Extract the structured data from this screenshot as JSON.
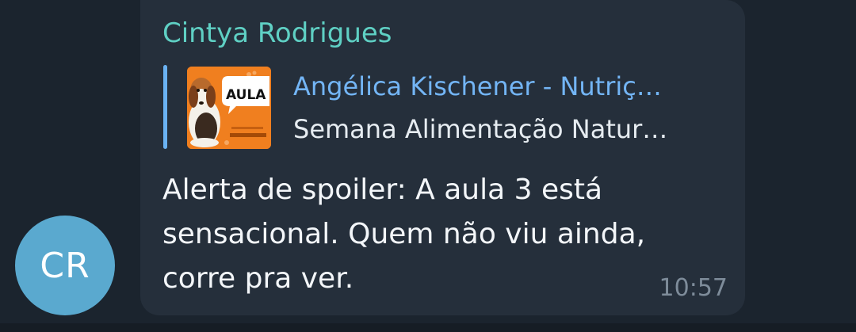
{
  "avatar": {
    "initials": "CR",
    "color": "#5aa9cf"
  },
  "message": {
    "sender": "Cintya Rodrigues",
    "reply": {
      "title": "Angélica Kischener - Nutriç…",
      "text": "Semana Alimentação Natur…",
      "thumb": {
        "word": "AULA"
      }
    },
    "text": "Alerta de spoiler: A aula 3 está sensacional. Quem não viu ainda, corre pra ver.",
    "time": "10:57"
  },
  "colors": {
    "background": "#1b242e",
    "bubble": "#252f3b",
    "sender": "#5fd0c4",
    "link": "#73b5f5",
    "reply_bar": "#6ab2f2",
    "time": "#7e8c9a"
  }
}
